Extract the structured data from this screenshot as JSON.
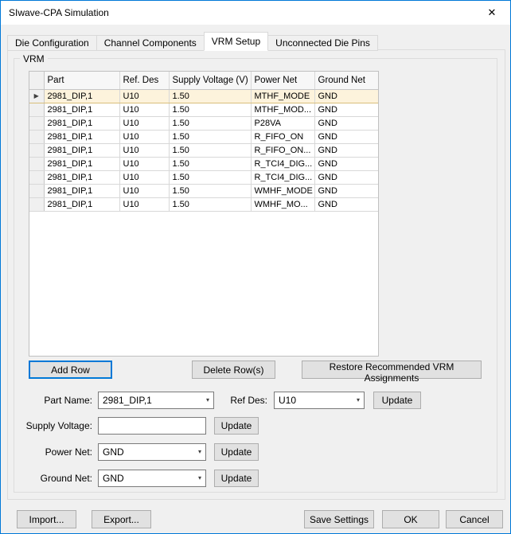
{
  "window": {
    "title": "SIwave-CPA Simulation",
    "close_glyph": "✕"
  },
  "tabs": [
    {
      "label": "Die Configuration",
      "active": false
    },
    {
      "label": "Channel Components",
      "active": false
    },
    {
      "label": "VRM Setup",
      "active": true
    },
    {
      "label": "Unconnected Die Pins",
      "active": false
    }
  ],
  "vrm": {
    "group_label": "VRM",
    "table": {
      "columns": [
        "Part",
        "Ref. Des",
        "Supply Voltage (V)",
        "Power Net",
        "Ground Net"
      ],
      "rows": [
        {
          "part": "2981_DIP,1",
          "ref_des": "U10",
          "supply_voltage": "1.50",
          "power_net": "MTHF_MODE",
          "ground_net": "GND",
          "selected": true
        },
        {
          "part": "2981_DIP,1",
          "ref_des": "U10",
          "supply_voltage": "1.50",
          "power_net": "MTHF_MOD...",
          "ground_net": "GND",
          "selected": false
        },
        {
          "part": "2981_DIP,1",
          "ref_des": "U10",
          "supply_voltage": "1.50",
          "power_net": "P28VA",
          "ground_net": "GND",
          "selected": false
        },
        {
          "part": "2981_DIP,1",
          "ref_des": "U10",
          "supply_voltage": "1.50",
          "power_net": "R_FIFO_ON",
          "ground_net": "GND",
          "selected": false
        },
        {
          "part": "2981_DIP,1",
          "ref_des": "U10",
          "supply_voltage": "1.50",
          "power_net": "R_FIFO_ON...",
          "ground_net": "GND",
          "selected": false
        },
        {
          "part": "2981_DIP,1",
          "ref_des": "U10",
          "supply_voltage": "1.50",
          "power_net": "R_TCI4_DIG...",
          "ground_net": "GND",
          "selected": false
        },
        {
          "part": "2981_DIP,1",
          "ref_des": "U10",
          "supply_voltage": "1.50",
          "power_net": "R_TCI4_DIG...",
          "ground_net": "GND",
          "selected": false
        },
        {
          "part": "2981_DIP,1",
          "ref_des": "U10",
          "supply_voltage": "1.50",
          "power_net": "WMHF_MODE",
          "ground_net": "GND",
          "selected": false
        },
        {
          "part": "2981_DIP,1",
          "ref_des": "U10",
          "supply_voltage": "1.50",
          "power_net": "WMHF_MO...",
          "ground_net": "GND",
          "selected": false
        }
      ]
    },
    "buttons": {
      "add_row": "Add Row",
      "delete_rows": "Delete Row(s)",
      "restore": "Restore Recommended VRM Assignments"
    },
    "form": {
      "part_name_label": "Part Name:",
      "part_name_value": "2981_DIP,1",
      "ref_des_label": "Ref Des:",
      "ref_des_value": "U10",
      "supply_voltage_label": "Supply Voltage:",
      "supply_voltage_value": "",
      "power_net_label": "Power Net:",
      "power_net_value": "GND",
      "ground_net_label": "Ground Net:",
      "ground_net_value": "GND",
      "update_label": "Update",
      "dropdown_glyph": "▾"
    }
  },
  "footer": {
    "import": "Import...",
    "export": "Export...",
    "save_settings": "Save Settings",
    "ok": "OK",
    "cancel": "Cancel"
  },
  "colors": {
    "accent": "#0078d7",
    "selected_row_bg": "#fdf3dc",
    "selected_row_border": "#d9bf7a"
  }
}
